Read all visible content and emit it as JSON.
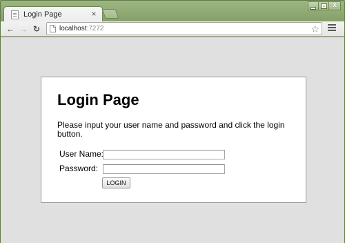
{
  "browser": {
    "tab": {
      "title": "Login Page",
      "favicon": "page-icon",
      "close_glyph": "×"
    },
    "nav": {
      "back_glyph": "←",
      "forward_glyph": "→",
      "reload_glyph": "↻"
    },
    "address": {
      "host": "localhost",
      "port": ":7272"
    },
    "star_glyph": "☆"
  },
  "page": {
    "heading": "Login Page",
    "instructions": "Please input your user name and password and click the login button.",
    "form": {
      "username_label": "User Name:",
      "username_value": "",
      "password_label": "Password:",
      "password_value": "",
      "submit_label": "LOGIN"
    }
  },
  "colors": {
    "frame": "#86a06a",
    "content_background": "#e0e0e0",
    "card_background": "#ffffff"
  }
}
